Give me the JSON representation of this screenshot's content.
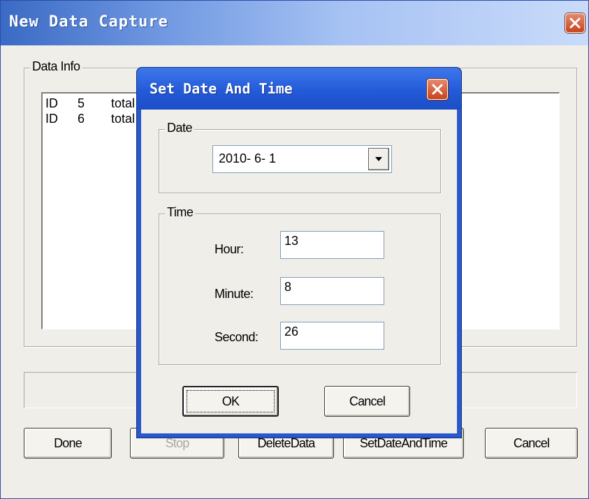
{
  "main_window": {
    "title": "New Data Capture",
    "data_info": {
      "label": "Data Info",
      "rows": [
        {
          "id_label": "ID",
          "id_value": "5",
          "col3": "total"
        },
        {
          "id_label": "ID",
          "id_value": "6",
          "col3": "total"
        }
      ]
    },
    "status_text": "",
    "buttons": {
      "done": "Done",
      "stop": "Stop",
      "delete_data": "DeleteData",
      "set_date_time": "SetDateAndTime",
      "cancel": "Cancel"
    }
  },
  "dialog": {
    "title": "Set Date And Time",
    "date_group_label": "Date",
    "date_value": "2010- 6- 1",
    "time_group_label": "Time",
    "hour_label": "Hour:",
    "hour_value": "13",
    "minute_label": "Minute:",
    "minute_value": "8",
    "second_label": "Second:",
    "second_value": "26",
    "ok_label": "OK",
    "cancel_label": "Cancel"
  },
  "icons": {
    "close": "close-icon",
    "dropdown": "chevron-down-icon"
  },
  "colors": {
    "xp_blue": "#2858cc",
    "close_red": "#c9431c",
    "window_face": "#efeee9"
  }
}
